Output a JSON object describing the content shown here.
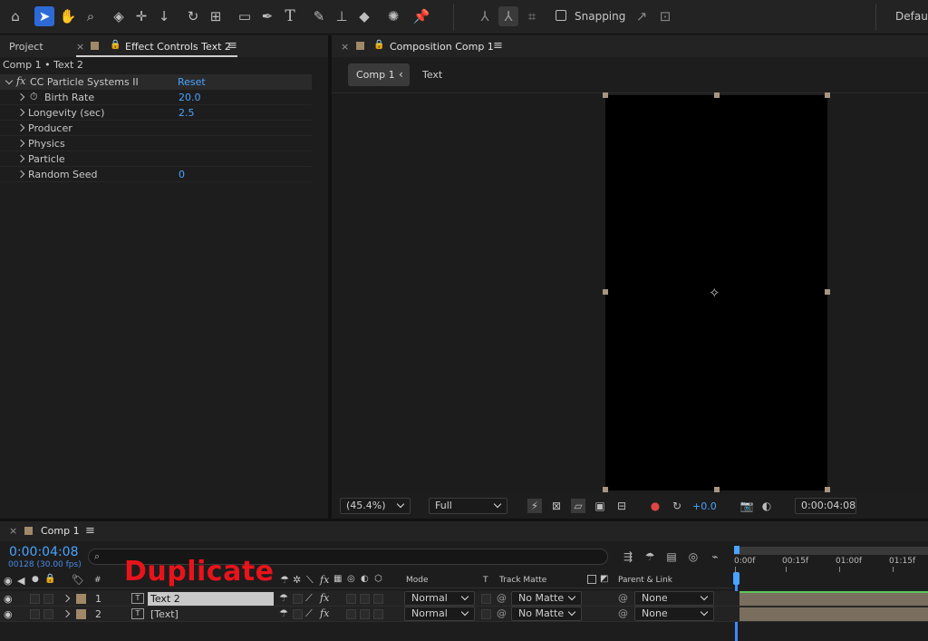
{
  "toolbar": {
    "tools": [
      "home-icon",
      "selection-arrow-icon",
      "hand-icon",
      "zoom-icon",
      "orbit-icon",
      "pan-icon",
      "dolly-icon",
      "rotate-icon",
      "pan-behind-icon",
      "rectangle-icon",
      "pen-icon",
      "type-icon",
      "brush-icon",
      "clone-stamp-icon",
      "eraser-icon",
      "roto-brush-icon",
      "puppet-pin-icon"
    ],
    "snapping_label": "Snapping",
    "workspace_label": "Default"
  },
  "left_panel": {
    "tab_project": "Project",
    "tab_effect_controls": "Effect Controls Text 2",
    "breadcrumb": "Comp 1 • Text 2",
    "effect": {
      "fx_label": "fx",
      "name": "CC Particle Systems II",
      "reset_label": "Reset"
    },
    "properties": [
      {
        "name": "Birth Rate",
        "value": "20.0"
      },
      {
        "name": "Longevity (sec)",
        "value": "2.5"
      },
      {
        "name": "Producer",
        "value": ""
      },
      {
        "name": "Physics",
        "value": ""
      },
      {
        "name": "Particle",
        "value": ""
      },
      {
        "name": "Random Seed",
        "value": "0"
      }
    ]
  },
  "composition_panel": {
    "tab_label": "Composition Comp 1",
    "breadcrumb_comp": "Comp 1",
    "breadcrumb_layer": "Text",
    "footer": {
      "zoom": "(45.4%)",
      "resolution": "Full",
      "exposure": "+0.0",
      "timecode": "0:00:04:08"
    }
  },
  "timeline": {
    "tab_label": "Comp 1",
    "timecode": "0:00:04:08",
    "frame_info": "00128 (30.00 fps)",
    "search_placeholder": "",
    "overlay_text": "Duplicate",
    "columns": {
      "num": "#",
      "mode": "Mode",
      "t": "T",
      "track_matte": "Track Matte",
      "parent": "Parent & Link"
    },
    "ruler": [
      "0:00f",
      "00:15f",
      "01:00f",
      "01:15f"
    ],
    "layers": [
      {
        "num": "1",
        "name": "Text 2",
        "mode": "Normal",
        "matte": "No Matte",
        "parent": "None",
        "selected": true
      },
      {
        "num": "2",
        "name": "[Text]",
        "mode": "Normal",
        "matte": "No Matte",
        "parent": "None",
        "selected": false
      }
    ]
  },
  "colors": {
    "accent_blue": "#2d6ad6",
    "value_blue": "#4aa3ff",
    "label_swatch": "#a08868",
    "overlay_red": "#e8131b"
  }
}
